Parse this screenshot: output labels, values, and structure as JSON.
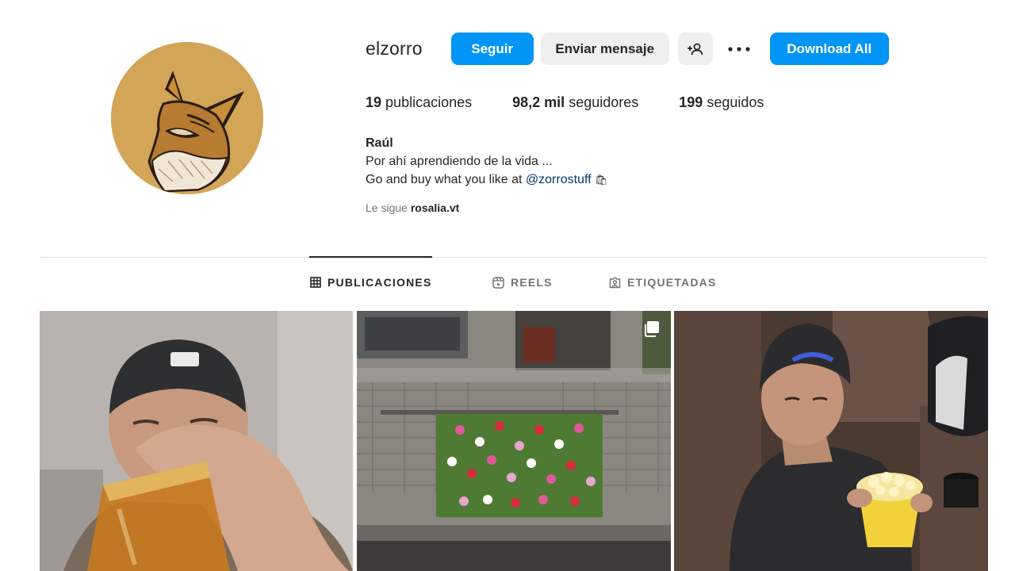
{
  "profile": {
    "username": "elzorro",
    "follow_label": "Seguir",
    "message_label": "Enviar mensaje",
    "download_label": "Download All",
    "colors": {
      "primary": "#0095f6",
      "secondary": "#efefef",
      "avatar_bg": "#d3a557"
    }
  },
  "stats": {
    "posts_count": "19",
    "posts_label": "publicaciones",
    "followers_count": "98,2 mil",
    "followers_label": "seguidores",
    "following_count": "199",
    "following_label": "seguidos"
  },
  "bio": {
    "name": "Raúl",
    "line1": "Por ahí aprendiendo de la vida ...",
    "line2_prefix": "Go and buy what you like at",
    "line2_link": "@zorrostuff",
    "line2_emoji": "🛍"
  },
  "followed_by": {
    "prefix": "Le sigue",
    "user": "rosalia.vt"
  },
  "tabs": [
    {
      "label": "PUBLICACIONES",
      "icon": "grid-icon",
      "active": true
    },
    {
      "label": "REELS",
      "icon": "reels-icon",
      "active": false
    },
    {
      "label": "ETIQUETADAS",
      "icon": "tagged-icon",
      "active": false
    }
  ],
  "posts": [
    {
      "icon": "photo",
      "multi": false
    },
    {
      "icon": "photo",
      "multi": true
    },
    {
      "icon": "photo",
      "multi": false
    }
  ]
}
